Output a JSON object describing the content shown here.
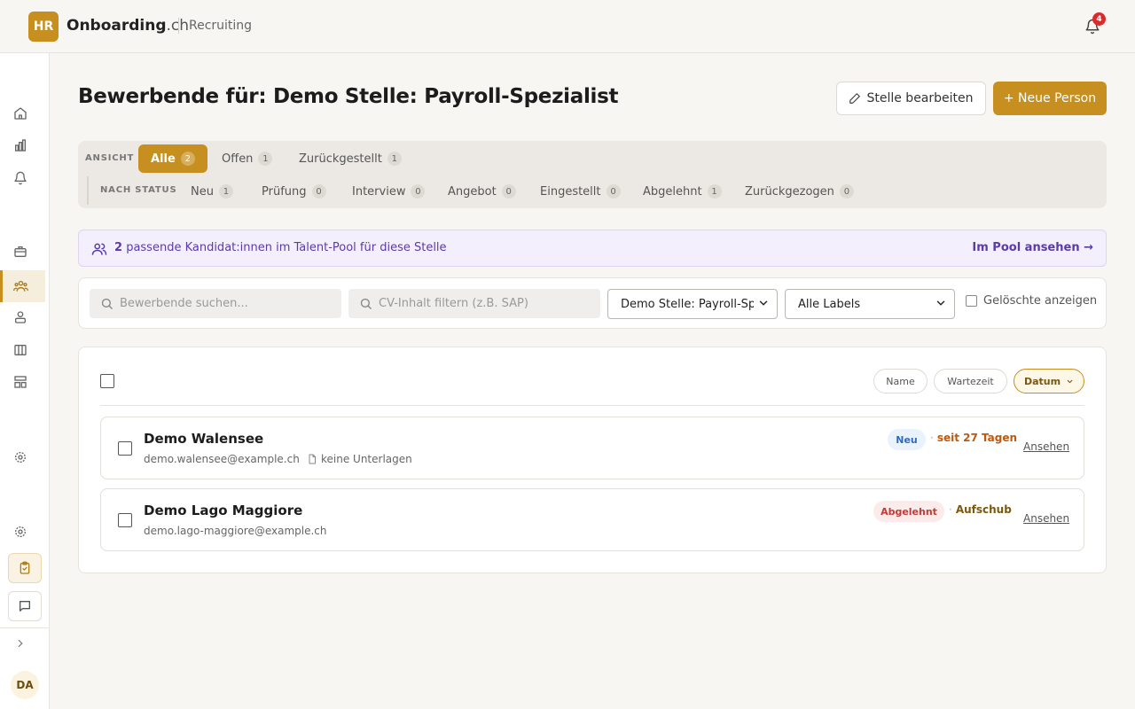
{
  "header": {
    "logo": "HR",
    "brand_name": "Onboarding",
    "brand_tld": ".ch",
    "module": "Recruiting",
    "notifications_count": "4"
  },
  "sidebar": {
    "user_initials": "DA",
    "icons": [
      "home-icon",
      "chart-icon",
      "bell-icon",
      "briefcase-icon",
      "users-icon",
      "user-group-icon",
      "columns-icon",
      "layout-icon",
      "gear-icon",
      "settings-icon",
      "clipboard-check-icon",
      "chat-icon",
      "chevron-right-icon"
    ]
  },
  "page": {
    "title": "Bewerbende für: Demo Stelle: Payroll-Spezialist",
    "edit_button": "Stelle bearbeiten",
    "new_button": "+ Neue Person"
  },
  "view_tabs": {
    "label": "ANSICHT",
    "items": [
      {
        "label": "Alle",
        "count": "2",
        "active": true
      },
      {
        "label": "Offen",
        "count": "1"
      },
      {
        "label": "Zurückgestellt",
        "count": "1"
      }
    ]
  },
  "status_tabs": {
    "label": "NACH STATUS",
    "items": [
      {
        "label": "Neu",
        "count": "1"
      },
      {
        "label": "Prüfung",
        "count": "0"
      },
      {
        "label": "Interview",
        "count": "0"
      },
      {
        "label": "Angebot",
        "count": "0"
      },
      {
        "label": "Eingestellt",
        "count": "0"
      },
      {
        "label": "Abgelehnt",
        "count": "1"
      },
      {
        "label": "Zurückgezogen",
        "count": "0"
      }
    ]
  },
  "pool_banner": {
    "count": "2",
    "text": "passende Kandidat:innen im Talent-Pool für diese Stelle",
    "link": "Im Pool ansehen →"
  },
  "filters": {
    "search_placeholder": "Bewerbende suchen...",
    "cv_placeholder": "CV-Inhalt filtern (z.B. SAP)",
    "job_select": "Demo Stelle: Payroll-Spez",
    "labels_select": "Alle Labels",
    "deleted_label": "Gelöschte anzeigen"
  },
  "sort": {
    "name": "Name",
    "wait": "Wartezeit",
    "date": "Datum"
  },
  "candidates": [
    {
      "name": "Demo Walensee",
      "email": "demo.walensee@example.ch",
      "docs": "keine Unterlagen",
      "status": "Neu",
      "meta": "seit 27 Tagen",
      "action": "Ansehen"
    },
    {
      "name": "Demo Lago Maggiore",
      "email": "demo.lago-maggiore@example.ch",
      "status": "Abgelehnt",
      "meta": "Aufschub",
      "action": "Ansehen"
    }
  ]
}
